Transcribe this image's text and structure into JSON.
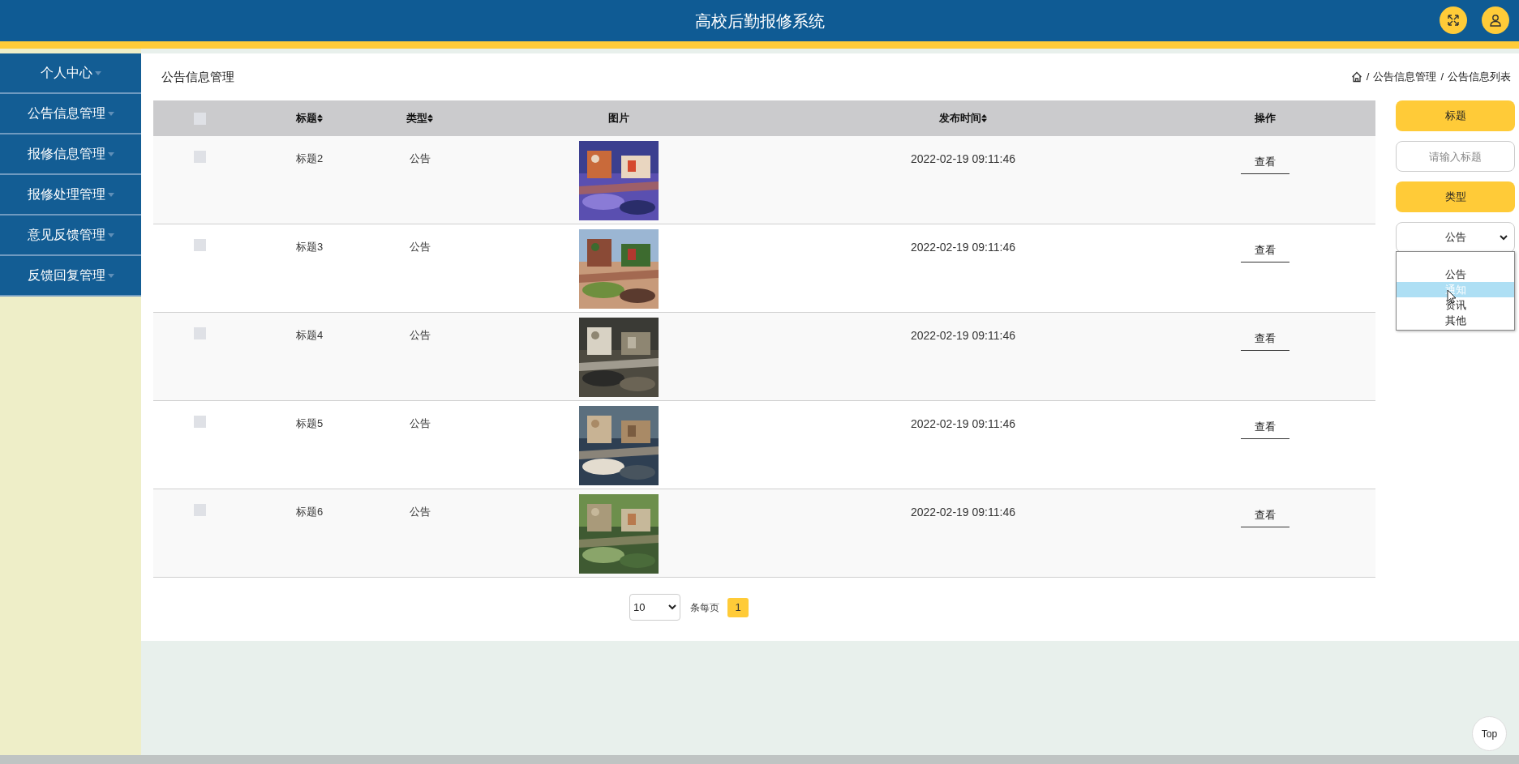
{
  "header": {
    "title": "高校后勤报修系统"
  },
  "sidebar": {
    "items": [
      {
        "label": "个人中心"
      },
      {
        "label": "公告信息管理"
      },
      {
        "label": "报修信息管理"
      },
      {
        "label": "报修处理管理"
      },
      {
        "label": "意见反馈管理"
      },
      {
        "label": "反馈回复管理"
      }
    ]
  },
  "page_title": "公告信息管理",
  "breadcrumb": [
    {
      "separator": "/",
      "label": "公告信息管理"
    },
    {
      "separator": "/",
      "label": "公告信息列表"
    }
  ],
  "select_all": {
    "checked": false
  },
  "table": {
    "columns": [
      {
        "label": "标题",
        "sortable": true
      },
      {
        "label": "类型",
        "sortable": true
      },
      {
        "label": "图片",
        "sortable": false
      },
      {
        "label": "发布时间",
        "sortable": true
      },
      {
        "label": "操作",
        "sortable": false
      }
    ],
    "rows": [
      {
        "checked": false,
        "title": "标题2",
        "type": "公告",
        "time": "2022-02-19 09:11:46",
        "action": "查看"
      },
      {
        "checked": false,
        "title": "标题3",
        "type": "公告",
        "time": "2022-02-19 09:11:46",
        "action": "查看"
      },
      {
        "checked": false,
        "title": "标题4",
        "type": "公告",
        "time": "2022-02-19 09:11:46",
        "action": "查看"
      },
      {
        "checked": false,
        "title": "标题5",
        "type": "公告",
        "time": "2022-02-19 09:11:46",
        "action": "查看"
      },
      {
        "checked": false,
        "title": "标题6",
        "type": "公告",
        "time": "2022-02-19 09:11:46",
        "action": "查看"
      }
    ]
  },
  "pagination": {
    "page_size": "10",
    "per_page_label": "条每页",
    "pages": [
      {
        "label": "1",
        "selected": true
      }
    ]
  },
  "filters": {
    "title_label": "标题",
    "title_placeholder": "请输入标题",
    "type_label": "类型",
    "type_value": "公告",
    "type_options": [
      {
        "label": "公告",
        "highlighted": false
      },
      {
        "label": "通知",
        "highlighted": true
      },
      {
        "label": "资讯",
        "highlighted": false
      },
      {
        "label": "其他",
        "highlighted": false
      }
    ]
  },
  "top_button": "Top"
}
